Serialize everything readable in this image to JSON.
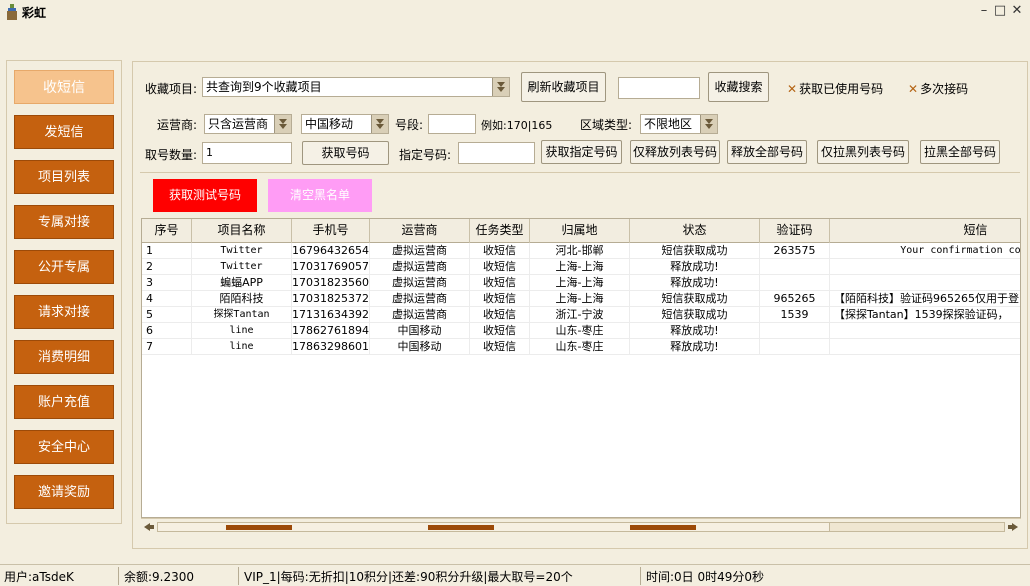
{
  "window": {
    "title": "彩虹"
  },
  "sidebar": {
    "items": [
      {
        "label": "收短信",
        "active": true
      },
      {
        "label": "发短信"
      },
      {
        "label": "项目列表"
      },
      {
        "label": "专属对接"
      },
      {
        "label": "公开专属"
      },
      {
        "label": "请求对接"
      },
      {
        "label": "消费明细"
      },
      {
        "label": "账户充值"
      },
      {
        "label": "安全中心"
      },
      {
        "label": "邀请奖励"
      }
    ]
  },
  "form": {
    "collect_label": "收藏项目:",
    "collect_value": "共查询到9个收藏项目",
    "refresh_collect_button": "刷新收藏项目",
    "collect_search_value": "",
    "collect_search_button": "收藏搜索",
    "used_number_check": "获取已使用号码",
    "multi_receive_check": "多次接码",
    "operator_label": "运营商:",
    "operator_value": "只含运营商",
    "carrier_value": "中国移动",
    "segment_label": "号段:",
    "segment_value": "",
    "segment_example": "例如:170|165",
    "region_label": "区域类型:",
    "region_value": "不限地区",
    "quantity_label": "取号数量:",
    "quantity_value": "1",
    "get_number_button": "获取号码",
    "assign_label": "指定号码:",
    "assign_value": "",
    "get_assigned_button": "获取指定号码",
    "release_list_button": "仅释放列表号码",
    "release_all_button": "释放全部号码",
    "blacklist_list_button": "仅拉黑列表号码",
    "blacklist_all_button": "拉黑全部号码"
  },
  "actions": {
    "test_number_button": "获取测试号码",
    "clear_blacklist_button": "清空黑名单"
  },
  "table": {
    "columns": [
      "序号",
      "项目名称",
      "手机号",
      "运营商",
      "任务类型",
      "归属地",
      "状态",
      "验证码",
      "短信"
    ],
    "rows": [
      [
        "1",
        "Twitter",
        "16796432654",
        "虚拟运营商",
        "收短信",
        "河北-邯郸",
        "短信获取成功",
        "263575",
        "Your confirmation code is"
      ],
      [
        "2",
        "Twitter",
        "17031769057",
        "虚拟运营商",
        "收短信",
        "上海-上海",
        "释放成功!",
        "",
        ""
      ],
      [
        "3",
        "蝙蝠APP",
        "17031823560",
        "虚拟运营商",
        "收短信",
        "上海-上海",
        "释放成功!",
        "",
        ""
      ],
      [
        "4",
        "陌陌科技",
        "17031825372",
        "虚拟运营商",
        "收短信",
        "上海-上海",
        "短信获取成功",
        "965265",
        "【陌陌科技】验证码965265仅用于登"
      ],
      [
        "5",
        "探探Tantan",
        "17131634392",
        "虚拟运营商",
        "收短信",
        "浙江-宁波",
        "短信获取成功",
        "1539",
        "【探探Tantan】1539探探验证码，"
      ],
      [
        "6",
        "line",
        "17862761894",
        "中国移动",
        "收短信",
        "山东-枣庄",
        "释放成功!",
        "",
        ""
      ],
      [
        "7",
        "line",
        "17863298601",
        "中国移动",
        "收短信",
        "山东-枣庄",
        "释放成功!",
        "",
        ""
      ]
    ]
  },
  "status": {
    "user": "用户:aTsdeK",
    "balance": "余额:9.2300",
    "vip": "VIP_1|每码:无折扣|10积分|还差:90积分升级|最大取号=20个",
    "time": "时间:0日  0时49分0秒"
  },
  "colors": {
    "sidebar_button": "#c5610f",
    "sidebar_active": "#f6c38d",
    "test_button": "#ff0000",
    "clear_button": "#ff9cf5",
    "background": "#f3eedf"
  }
}
